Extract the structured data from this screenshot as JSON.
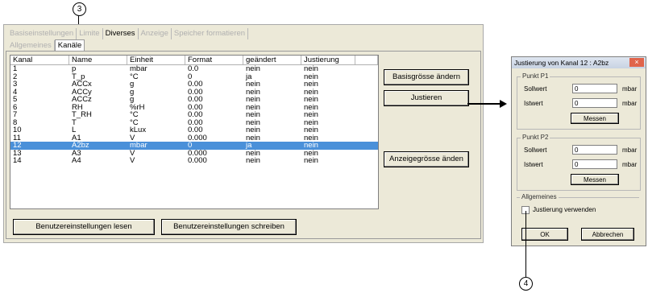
{
  "callouts": {
    "top": "3",
    "bottom": "4"
  },
  "main": {
    "tabs_row1": [
      {
        "label": "Basiseinstellungen",
        "state": "dim"
      },
      {
        "label": "Limite",
        "state": "dim"
      },
      {
        "label": "Diverses",
        "state": "dark"
      },
      {
        "label": "Anzeige",
        "state": "dim"
      },
      {
        "label": "Speicher formatieren",
        "state": "dim"
      }
    ],
    "tabs_row2": [
      {
        "label": "Allgemeines",
        "state": "dim"
      },
      {
        "label": "Kanäle",
        "state": "sel"
      }
    ],
    "columns": [
      "Kanal",
      "Name",
      "Einheit",
      "Format",
      "geändert",
      "Justierung"
    ],
    "rows": [
      [
        "1",
        "p",
        "mbar",
        "0.0",
        "nein",
        "nein"
      ],
      [
        "2",
        "T_p",
        "°C",
        "0",
        "ja",
        "nein"
      ],
      [
        "3",
        "ACCx",
        "g",
        "0.00",
        "nein",
        "nein"
      ],
      [
        "4",
        "ACCy",
        "g",
        "0.00",
        "nein",
        "nein"
      ],
      [
        "5",
        "ACCz",
        "g",
        "0.00",
        "nein",
        "nein"
      ],
      [
        "6",
        "RH",
        "%rH",
        "0.00",
        "nein",
        "nein"
      ],
      [
        "7",
        "T_RH",
        "°C",
        "0.00",
        "nein",
        "nein"
      ],
      [
        "8",
        "T",
        "°C",
        "0.00",
        "nein",
        "nein"
      ],
      [
        "10",
        "L",
        "kLux",
        "0.00",
        "nein",
        "nein"
      ],
      [
        "11",
        "A1",
        "V",
        "0.000",
        "nein",
        "nein"
      ],
      [
        "12",
        "A2bz",
        "mbar",
        "0",
        "ja",
        "nein"
      ],
      [
        "13",
        "A3",
        "V",
        "0.000",
        "nein",
        "nein"
      ],
      [
        "14",
        "A4",
        "V",
        "0.000",
        "nein",
        "nein"
      ]
    ],
    "selected_row": 10,
    "buttons": {
      "basis": "Basisgrösse ändern",
      "justieren": "Justieren",
      "anzeige": "Anzeigegrösse änden",
      "lesen": "Benutzereinstellungen lesen",
      "schreiben": "Benutzereinstellungen schreiben"
    }
  },
  "dialog": {
    "title": "Justierung von Kanal 12 : A2bz",
    "close": "×",
    "p1": {
      "title": "Punkt P1",
      "soll_label": "Sollwert",
      "soll_value": "0",
      "ist_label": "Istwert",
      "ist_value": "0",
      "unit": "mbar",
      "messen": "Messen"
    },
    "p2": {
      "title": "Punkt P2",
      "soll_label": "Sollwert",
      "soll_value": "0",
      "ist_label": "Istwert",
      "ist_value": "0",
      "unit": "mbar",
      "messen": "Messen"
    },
    "general": {
      "title": "Allgemeines",
      "checkbox_label": "Justierung verwenden"
    },
    "ok": "OK",
    "cancel": "Abbrechen"
  },
  "colors": {
    "selection": "#4a90d9",
    "window_bg": "#ece9d8",
    "close_btn": "#e0644b"
  }
}
